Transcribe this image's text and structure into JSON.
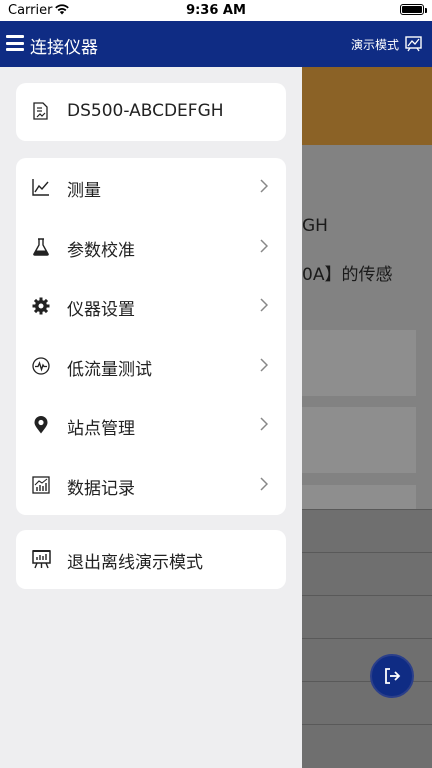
{
  "status_bar": {
    "carrier": "Carrier",
    "time": "9:36 AM"
  },
  "nav": {
    "title": "连接仪器",
    "demo_mode": "演示模式"
  },
  "background": {
    "serial_fragment": "GH",
    "sensor_fragment": "0A】的传感"
  },
  "drawer": {
    "device_name": "DS500-ABCDEFGH",
    "menu_items": [
      {
        "label": "测量",
        "icon": "line-chart-icon"
      },
      {
        "label": "参数校准",
        "icon": "flask-icon"
      },
      {
        "label": "仪器设置",
        "icon": "gear-icon"
      },
      {
        "label": "低流量测试",
        "icon": "pulse-icon"
      },
      {
        "label": "站点管理",
        "icon": "location-pin-icon"
      },
      {
        "label": "数据记录",
        "icon": "bar-chart-icon"
      }
    ],
    "exit_label": "退出离线演示模式"
  },
  "colors": {
    "nav_bg": "#0f2c84",
    "drawer_bg": "#eeeef0",
    "banner": "#8b6226"
  }
}
